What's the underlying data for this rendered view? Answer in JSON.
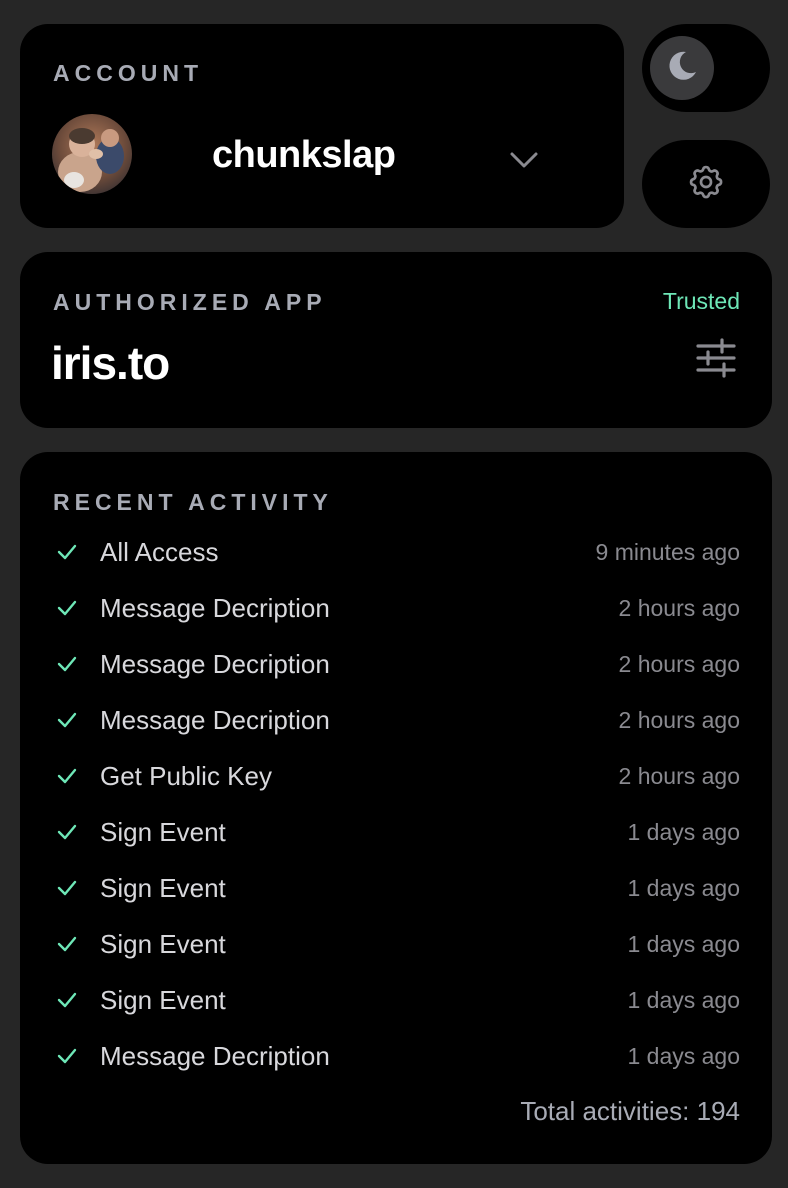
{
  "account": {
    "section_label": "ACCOUNT",
    "username": "chunkslap"
  },
  "authorized_app": {
    "section_label": "AUTHORIZED APP",
    "status": "Trusted",
    "app_name": "iris.to"
  },
  "recent_activity": {
    "section_label": "RECENT ACTIVITY",
    "items": [
      {
        "name": "All Access",
        "time": "9 minutes ago"
      },
      {
        "name": "Message Decription",
        "time": "2 hours ago"
      },
      {
        "name": "Message Decription",
        "time": "2 hours ago"
      },
      {
        "name": "Message Decription",
        "time": "2 hours ago"
      },
      {
        "name": "Get Public Key",
        "time": "2 hours ago"
      },
      {
        "name": "Sign Event",
        "time": "1 days ago"
      },
      {
        "name": "Sign Event",
        "time": "1 days ago"
      },
      {
        "name": "Sign Event",
        "time": "1 days ago"
      },
      {
        "name": "Sign Event",
        "time": "1 days ago"
      },
      {
        "name": "Message Decription",
        "time": "1 days ago"
      }
    ],
    "total_text": "Total activities: 194"
  },
  "icons": {
    "theme_toggle": "moon-icon",
    "settings": "gear-icon",
    "account_switch": "chevron-down-icon",
    "app_settings": "sliders-icon",
    "activity_status": "check-icon"
  },
  "colors": {
    "background": "#262626",
    "card": "#000000",
    "accent_green": "#6ee7b7",
    "label_gray": "#a8abb5"
  }
}
